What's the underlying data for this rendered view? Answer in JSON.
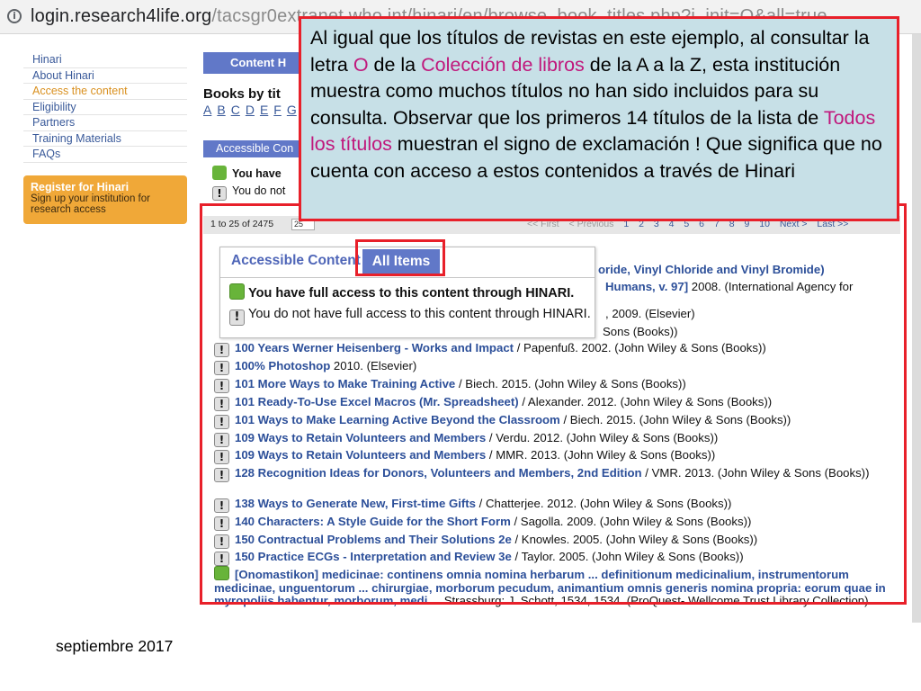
{
  "browser": {
    "url_host": "login.research4life.org",
    "url_path": "/tacsgr0extranet.who.int/hinari/en/browse_book_titles.php?i_init=O&all=true"
  },
  "sidebar": {
    "items": [
      {
        "label": "Hinari",
        "active": false
      },
      {
        "label": "About Hinari",
        "active": false
      },
      {
        "label": "Access the content",
        "active": true
      },
      {
        "label": "Eligibility",
        "active": false
      },
      {
        "label": "Partners",
        "active": false
      },
      {
        "label": "Training Materials",
        "active": false
      },
      {
        "label": "FAQs",
        "active": false
      }
    ],
    "register": {
      "title": "Register for Hinari",
      "description": "Sign up your institution for research access"
    }
  },
  "main": {
    "header": "Content H",
    "books_title": "Books by tit",
    "alphabet": [
      "A",
      "B",
      "C",
      "D",
      "E",
      "F",
      "G"
    ],
    "tab_bar": "Accessible Con",
    "legend_full": "You have",
    "legend_none": "You do not",
    "pager": {
      "count": "1 to 25 of 2475",
      "per_page": "25",
      "first": "<< First",
      "previous": "< Previous",
      "pages": [
        "1",
        "2",
        "3",
        "4",
        "5",
        "6",
        "7",
        "8",
        "9",
        "10"
      ],
      "next": "Next >",
      "last": "Last >>"
    }
  },
  "inset": {
    "tab_accessible": "Accessible Content",
    "tab_all": "All Items",
    "full_access": "You have full access to this content through HINARI.",
    "no_access": "You do not have full access to this content through HINARI."
  },
  "partials": {
    "p1_title": "oride, Vinyl Chloride and Vinyl Bromide)",
    "p2_title": "Humans, v. 97]",
    "p2_rest": " 2008. (International Agency for",
    "p3_rest": ", 2009. (Elsevier)",
    "p4_rest": "Sons (Books))"
  },
  "entries": [
    {
      "access": "none",
      "title": "100 Years Werner Heisenberg - Works and Impact",
      "rest": " / Papenfuß. 2002. (John Wiley & Sons (Books))"
    },
    {
      "access": "none",
      "title": "100% Photoshop",
      "rest": " 2010. (Elsevier)"
    },
    {
      "access": "none",
      "title": "101 More Ways to Make Training Active",
      "rest": " / Biech. 2015. (John Wiley & Sons (Books))"
    },
    {
      "access": "none",
      "title": "101 Ready-To-Use Excel Macros (Mr. Spreadsheet)",
      "rest": " / Alexander. 2012. (John Wiley & Sons (Books))"
    },
    {
      "access": "none",
      "title": "101 Ways to Make Learning Active Beyond the Classroom",
      "rest": " / Biech. 2015. (John Wiley & Sons (Books))"
    },
    {
      "access": "none",
      "title": "109 Ways to Retain Volunteers and Members",
      "rest": " / Verdu. 2012. (John Wiley & Sons (Books))"
    },
    {
      "access": "none",
      "title": "109 Ways to Retain Volunteers and Members",
      "rest": " / MMR. 2013. (John Wiley & Sons (Books))"
    },
    {
      "access": "none",
      "title": "128 Recognition Ideas for Donors, Volunteers and Members, 2nd Edition",
      "rest": " / VMR. 2013. (John Wiley & Sons (Books))"
    },
    {
      "access": "none",
      "title": "138 Ways to Generate New, First-time Gifts",
      "rest": " / Chatterjee. 2012. (John Wiley & Sons (Books))"
    },
    {
      "access": "none",
      "title": "140 Characters: A Style Guide for the Short Form",
      "rest": " / Sagolla. 2009. (John Wiley & Sons (Books))"
    },
    {
      "access": "none",
      "title": "150 Contractual Problems and Their Solutions 2e",
      "rest": " / Knowles. 2005. (John Wiley & Sons (Books))"
    },
    {
      "access": "none",
      "title": "150 Practice ECGs - Interpretation and Review 3e",
      "rest": " / Taylor. 2005. (John Wiley & Sons (Books))"
    },
    {
      "access": "full",
      "title": "[Onomastikon] medicinae: continens omnia nomina herbarum ... definitionum medicinalium, instrumentorum medicinae, unguentorum ... chirurgiae, morborum pecudum, animantium omnis generis nomina propria: eorum quae in myropoliis habentur, morborum, medi ...",
      "rest": " Strassburg: J. Schott, 1534, 1534. (ProQuest- Wellcome Trust Library Collection)"
    }
  ],
  "callout": {
    "p1": "Al igual que los títulos de revistas en este ejemplo, al consultar la letra ",
    "hl1": "O",
    "p2": " de la ",
    "hl2": "Colección de libros",
    "p3": " de la A a la Z, esta institución muestra como muchos títulos no han sido incluidos para su consulta. Observar que los primeros 14 títulos de la lista de ",
    "hl3": "Todos los títulos",
    "p4": " muestran el signo de exclamación ! Que significa que no cuenta con acceso a estos contenidos a través de Hinari"
  },
  "footer": {
    "date": "septiembre 2017"
  },
  "colors": {
    "accent_red": "#e8202a",
    "callout_bg": "#c7e0e7",
    "highlight": "#c0187c",
    "nav_blue": "#6178c8",
    "register_orange": "#f0a838",
    "full_green": "#68b43a"
  }
}
